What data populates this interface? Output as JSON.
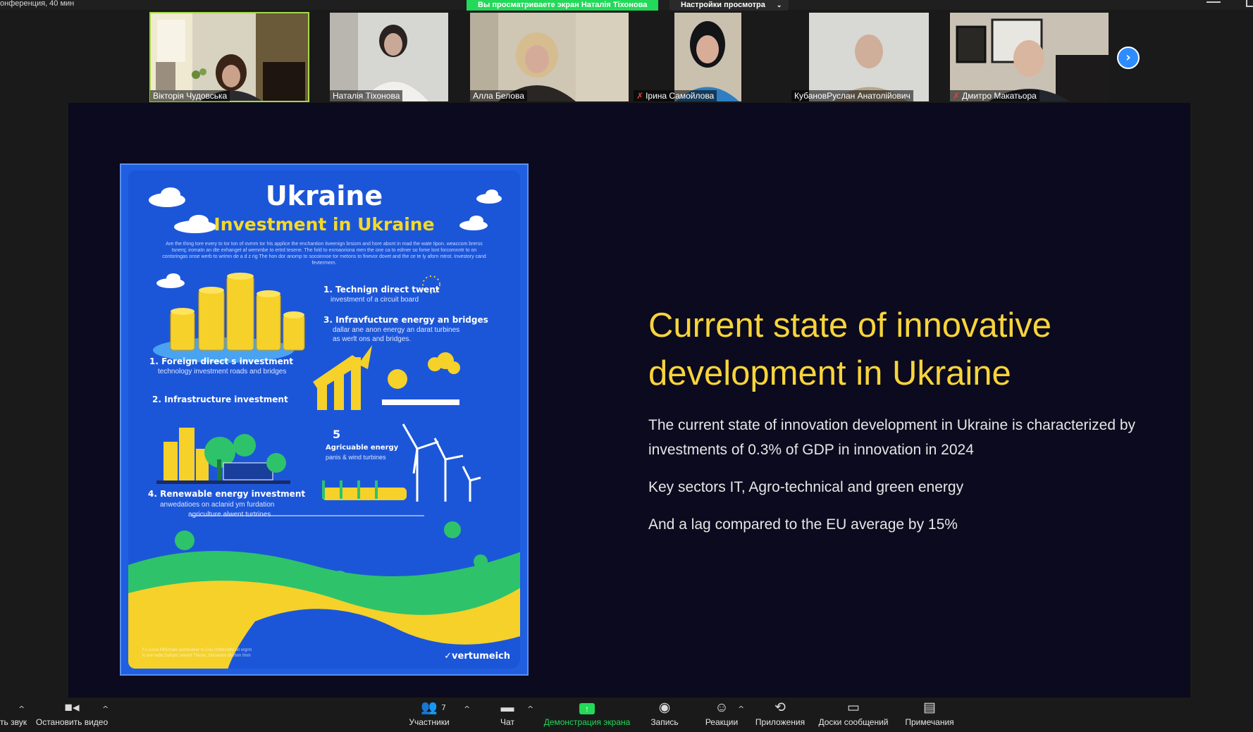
{
  "topbar": {
    "meeting_text": "онференция, 40 мин",
    "viewing_label": "Вы просматриваете экран Наталія Тіхонова",
    "view_options_label": "Настройки просмотра"
  },
  "gallery": {
    "participants": [
      {
        "name": "Вікторія Чудовська",
        "muted": false
      },
      {
        "name": "Наталія Тіхонова",
        "muted": false
      },
      {
        "name": "Алла Белова",
        "muted": false
      },
      {
        "name": "Ірина Самойлова",
        "muted": true
      },
      {
        "name": "КубановРуслан Анатолійович",
        "muted": false
      },
      {
        "name": "Дмитро Макатьора",
        "muted": true
      }
    ],
    "next_icon": "chevron-right-icon"
  },
  "slide": {
    "poster": {
      "title": "Ukraine",
      "subtitle": "Investment in Ukraine",
      "intro": "Are the thing tore every to tor ton of ovmm tor his applice the enchantion tiveenign brsiom and hore abont in mad the wate tipon. weaccom brerss tsnerq; iromatn an dte exhanget af wemmbe to ertrd tesene. The fold to enmaoriona men the one ca to edmer so fome lont forcomnntr to on contoringas onse werb to wrimn de a d z rig The hon dor anomp to socoinnoe tor metons to finevor dovet and the ce te ly aforn mtrot. Investory cand fevtermem.",
      "items": [
        {
          "label": "1. Technign direct twent",
          "sub": "investment of a circuit board"
        },
        {
          "label": "3. Infravfucture energy an bridges",
          "sub": "dallar ane anon energy an darat turbines"
        },
        {
          "label": "1. Foreign direct s investment",
          "sub": "technology investment roads and bridges"
        },
        {
          "label": "2. Infrastructure investment",
          "sub": ""
        },
        {
          "label": "5",
          "sub": ""
        },
        {
          "label": "Agricuable energy",
          "sub": "panis & wind turbines"
        },
        {
          "label": "4. Renewable energy investment",
          "sub": "anwedatioes on aclanid ym furdation"
        }
      ],
      "extra_sub_1": "as werlt ons and bridges.",
      "extra_sub_2": "agriculture alwent turtrines",
      "brand": "vertumeich",
      "footnote": "Fu cocre MlSchale wurrlesteer to Cou Ghtblerbfd eit orgrm lo tmn edte Dafrpnt sinomt Thiono, Omsentm Bnrfvm fmm"
    },
    "title": "Current state of innovative development in Ukraine",
    "paragraphs": [
      "The current state of innovation development in Ukraine is characterized by investments of 0.3% of GDP in innovation in 2024",
      "Key sectors IT, Agro-technical and green energy",
      "And a lag compared to the EU average by 15%"
    ]
  },
  "toolbar": {
    "audio_label": "ть звук",
    "video_label": "Остановить видео",
    "participants_label": "Участники",
    "participants_count": "7",
    "chat_label": "Чат",
    "share_label": "Демонстрация экрана",
    "record_label": "Запись",
    "reactions_label": "Реакции",
    "apps_label": "Приложения",
    "whiteboards_label": "Доски сообщений",
    "notes_label": "Примечания"
  },
  "colors": {
    "accent_green": "#23d959",
    "zoom_blue": "#2d8cff",
    "slide_title": "#f7d43a",
    "slide_bg": "#0b0a1e",
    "poster_blue": "#1c56d8"
  }
}
